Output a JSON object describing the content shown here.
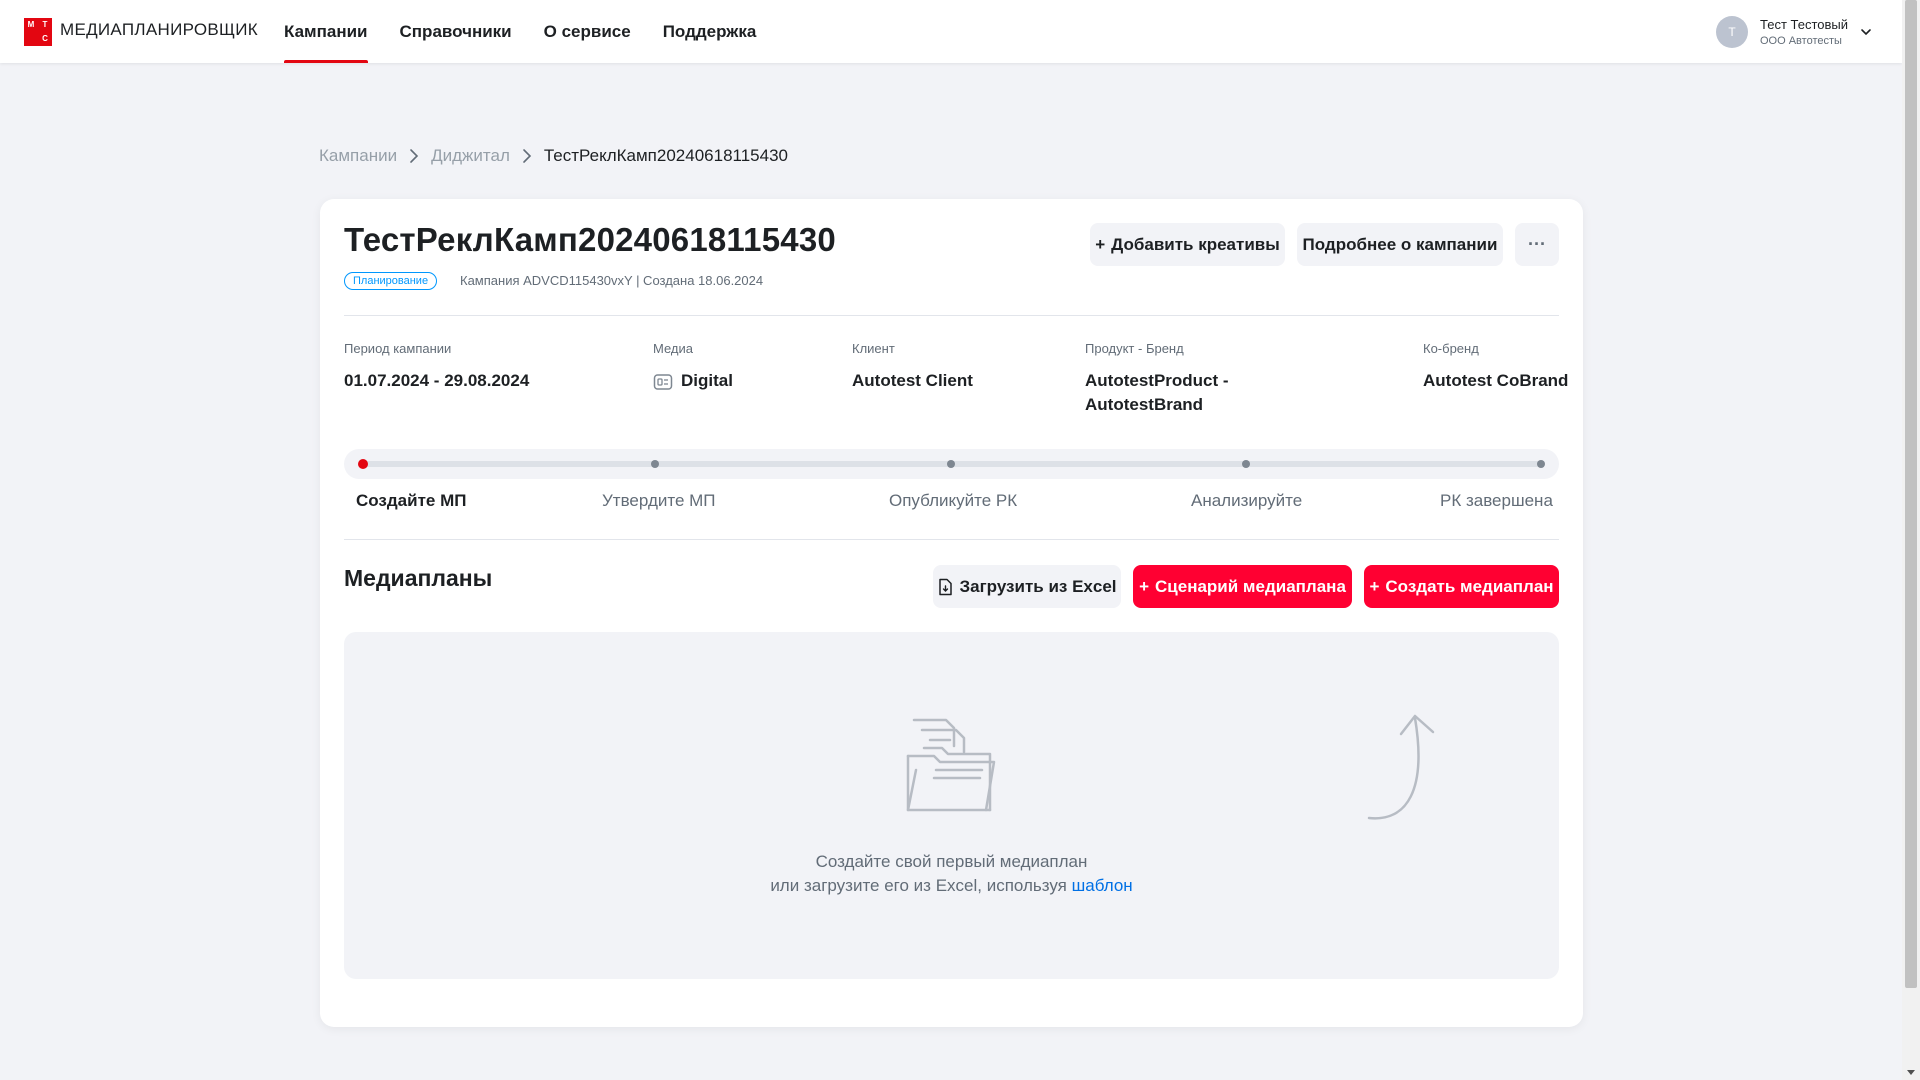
{
  "header": {
    "logo_letters": [
      "М",
      "Т",
      "",
      "С"
    ],
    "brand": "МЕДИАПЛАНИРОВЩИК",
    "nav": [
      {
        "label": "Кампании",
        "active": true
      },
      {
        "label": "Справочники",
        "active": false
      },
      {
        "label": "О сервисе",
        "active": false
      },
      {
        "label": "Поддержка",
        "active": false
      }
    ],
    "user": {
      "avatar_letter": "Т",
      "name": "Тест Тестовый",
      "org": "ООО Автотесты"
    }
  },
  "breadcrumb": {
    "items": [
      "Кампании",
      "Диджитал"
    ],
    "current": "ТестРеклКамп20240618115430"
  },
  "campaign": {
    "title": "ТестРеклКамп20240618115430",
    "status": "Планирование",
    "meta": "Кампания ADVCD115430vxY | Создана 18.06.2024",
    "buttons": {
      "add_creatives": "Добавить креативы",
      "details": "Подробнее о кампании",
      "more": "···"
    },
    "info": {
      "period_label": "Период кампании",
      "period_value": "01.07.2024 - 29.08.2024",
      "media_label": "Медиа",
      "media_value": "Digital",
      "client_label": "Клиент",
      "client_value": "Autotest Client",
      "product_label": "Продукт - Бренд",
      "product_value_line1": "AutotestProduct -",
      "product_value_line2": "AutotestBrand",
      "cobrand_label": "Ко-бренд",
      "cobrand_value": "Autotest CoBrand"
    },
    "steps": [
      {
        "label": "Создайте МП",
        "active": true
      },
      {
        "label": "Утвердите МП",
        "active": false
      },
      {
        "label": "Опубликуйте РК",
        "active": false
      },
      {
        "label": "Анализируйте",
        "active": false
      },
      {
        "label": "РК завершена",
        "active": false
      }
    ]
  },
  "mediaplans": {
    "title": "Медиапланы",
    "upload_excel": "Загрузить из Excel",
    "scenario": "Сценарий медиаплана",
    "create": "Создать медиаплан",
    "plus": "+",
    "empty_line1": "Создайте свой первый медиаплан",
    "empty_line2": "или загрузите его из Excel, используя",
    "empty_link": "шаблон"
  },
  "colors": {
    "accent_red": "#ff0032",
    "brand_red": "#e30611",
    "link_blue": "#0070e5",
    "badge_blue": "#0097fd"
  },
  "icons": [
    "chevron-down-icon",
    "chevron-right-icon",
    "more-icon",
    "media-digital-icon",
    "file-icon",
    "folder-illustration-icon",
    "arrow-up-illustration-icon"
  ]
}
